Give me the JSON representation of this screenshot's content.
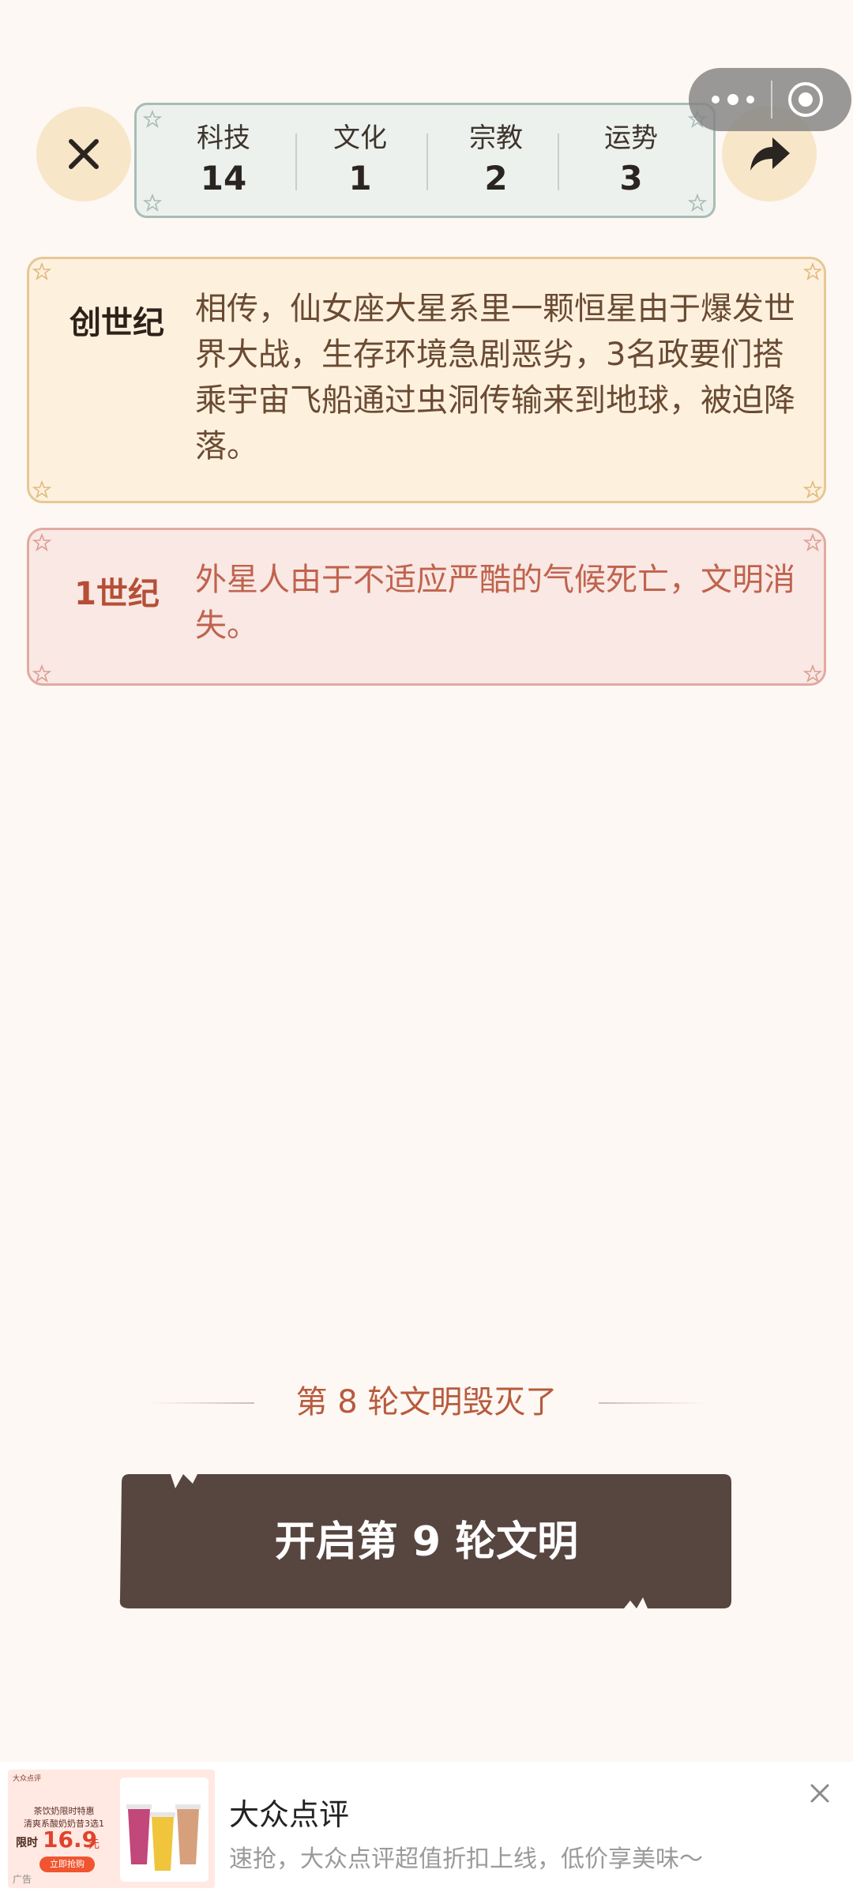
{
  "stats": [
    {
      "label": "科技",
      "value": "14"
    },
    {
      "label": "文化",
      "value": "1"
    },
    {
      "label": "宗教",
      "value": "2"
    },
    {
      "label": "运势",
      "value": "3"
    }
  ],
  "events": [
    {
      "era": "创世纪",
      "text": "相传，仙女座大星系里一颗恒星由于爆发世界大战，生存环境急剧恶劣，3名政要们搭乘宇宙飞船通过虫洞传输来到地球，被迫降落。"
    },
    {
      "era": "1世纪",
      "text": "外星人由于不适应严酷的气候死亡，文明消失。"
    }
  ],
  "destroyed_text": "第 8 轮文明毁灭了",
  "start_button_label": "开启第 9 轮文明",
  "ad": {
    "title": "大众点评",
    "subtitle": "速抢，大众点评超值折扣上线，低价享美味～",
    "thumb": {
      "brand": "大众点评",
      "line1": "茶饮奶限时特惠",
      "line2": "清爽系酸奶奶昔3选1",
      "limit": "限时",
      "price": "16.9",
      "unit": "元",
      "buy": "立即抢购",
      "tag": "广告"
    }
  },
  "colors": {
    "background": "#fdf8f3",
    "stats_panel": "#edf1ed",
    "genesis_card": "#fdf1de",
    "extinct_card": "#f9e8e4",
    "start_button": "#574540",
    "accent_red": "#b85a3d"
  },
  "icons": {
    "close": "close-icon",
    "share": "share-arrow-icon",
    "more": "more-dots-icon",
    "capsule_close": "target-circle-icon",
    "ad_close": "close-icon"
  }
}
